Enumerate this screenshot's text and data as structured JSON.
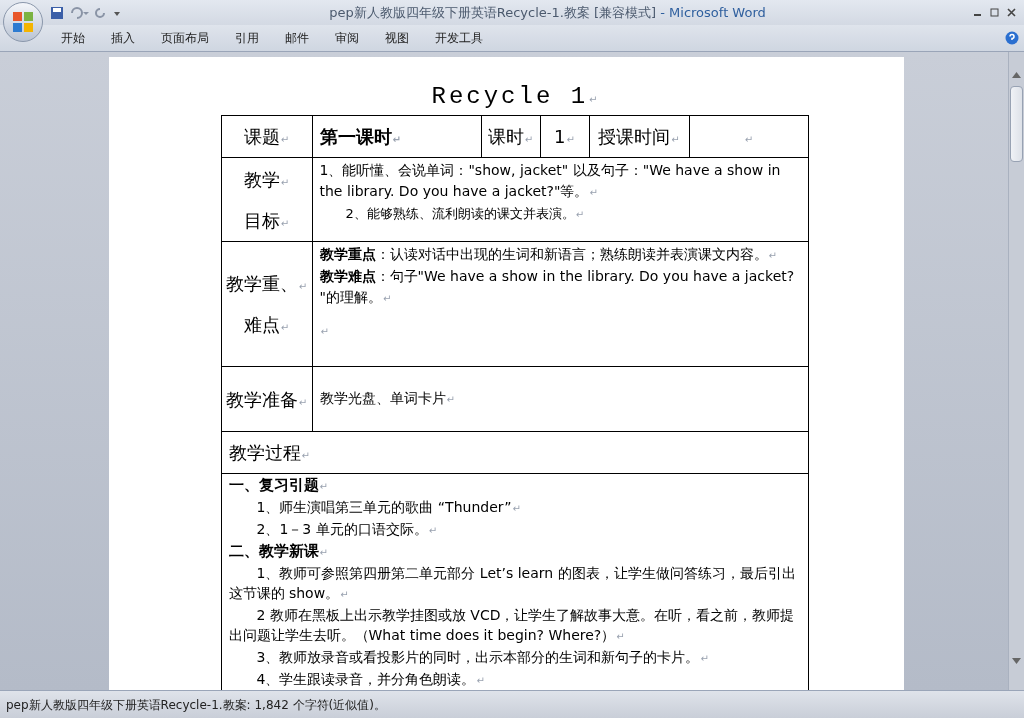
{
  "window": {
    "title": "pep新人教版四年级下册英语Recycle-1.教案 [兼容模式]",
    "app": " - Microsoft Word"
  },
  "ribbon_tabs": [
    {
      "label": "开始",
      "selected": false
    },
    {
      "label": "插入",
      "selected": false
    },
    {
      "label": "页面布局",
      "selected": false
    },
    {
      "label": "引用",
      "selected": false
    },
    {
      "label": "邮件",
      "selected": false
    },
    {
      "label": "审阅",
      "selected": false
    },
    {
      "label": "视图",
      "selected": false
    },
    {
      "label": "开发工具",
      "selected": false
    }
  ],
  "document": {
    "title": "Recycle 1",
    "mark": "↵",
    "header_row": [
      {
        "text": "课题",
        "bold": false
      },
      {
        "text": "第一课时",
        "bold": true
      },
      {
        "text": "课时",
        "bold": false
      },
      {
        "text": "1",
        "bold": false
      },
      {
        "text": "授课时间",
        "bold": false
      },
      {
        "bold": false
      }
    ],
    "rows": [
      {
        "label": [
          "教学",
          "目标"
        ],
        "paragraphs": [
          {
            "text": "1、能听懂、会说单词：\"show, jacket\" 以及句子：\"We have a show in the library. Do you have a jacket?\"等。",
            "indent": false,
            "small": false
          },
          {
            "text": "2、能够熟练、流利朗读的课文并表演。",
            "indent": true,
            "small": true
          }
        ]
      },
      {
        "label": [
          "教学重、",
          "难点"
        ],
        "paragraphs": [
          {
            "text": "**教学重点**：认读对话中出现的生词和新语言；熟练朗读并表演课文内容。",
            "indent": false,
            "small": false
          },
          {
            "text": "**教学难点**：句子\"We have a show in the library. Do you have a jacket? \"的理解。",
            "indent": false,
            "small": false
          },
          {
            "kind": "blank"
          }
        ]
      },
      {
        "label": [
          "教学准备"
        ],
        "paragraphs": [
          {
            "text": "教学光盘、单词卡片",
            "indent": false,
            "small": false
          }
        ]
      }
    ],
    "process_title": "教学过程",
    "process": [
      {
        "text": "一、复习引题",
        "heading": true
      },
      {
        "text": "1、师生演唱第三单元的歌曲 “Thunder”",
        "heading": false
      },
      {
        "text": "2、1－3 单元的口语交际。",
        "heading": false
      },
      {
        "text": "二、教学新课",
        "heading": true
      },
      {
        "text": "1、教师可参照第四册第二单元部分 Let’s learn 的图表，让学生做问答练习，最后引出这节课的 show。",
        "heading": false
      },
      {
        "text": "2 教师在黑板上出示教学挂图或放 VCD，让学生了解故事大意。在听，看之前，教师提出问题让学生去听。（What time does it begin? Where?）",
        "heading": false
      },
      {
        "text": "3、教师放录音或看投影片的同时，出示本部分的生词和新句子的卡片。",
        "heading": false
      },
      {
        "text": "4、学生跟读录音，并分角色朗读。",
        "heading": false
      }
    ]
  },
  "status_bar": "pep新人教版四年级下册英语Recycle-1.教案: 1,842 个字符(近似值)。"
}
